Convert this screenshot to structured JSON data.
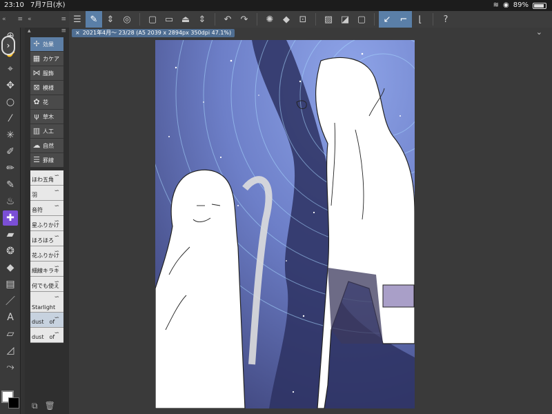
{
  "status_bar": {
    "time": "23:10",
    "date": "7月7日(水)",
    "battery": "89%",
    "battery_level": 0.89
  },
  "document": {
    "tab_title": "2021年4月～ 23/28 (A5 2039 x 2894px 350dpi 47.1%)"
  },
  "sub_tool_panel": {
    "categories": [
      {
        "label": "効果",
        "icon": "sparkle-plus-icon",
        "selected": true
      },
      {
        "label": "カケア",
        "icon": "crosshatch-icon"
      },
      {
        "label": "服飾",
        "icon": "ribbon-icon"
      },
      {
        "label": "模様",
        "icon": "pattern-icon"
      },
      {
        "label": "花",
        "icon": "flower-icon"
      },
      {
        "label": "草木",
        "icon": "grass-icon"
      },
      {
        "label": "人工",
        "icon": "building-icon"
      },
      {
        "label": "自然",
        "icon": "cloud-icon"
      },
      {
        "label": "罫線",
        "icon": "lines-icon"
      }
    ],
    "brushes": [
      {
        "label": "ほわ五角",
        "selected": false
      },
      {
        "label": "羽",
        "selected": false
      },
      {
        "label": "音符",
        "selected": false
      },
      {
        "label": "星ふりかけ",
        "selected": false
      },
      {
        "label": "ほろほろ",
        "selected": false
      },
      {
        "label": "花ふりかけ",
        "selected": false
      },
      {
        "label": "細線キラキ",
        "selected": false
      },
      {
        "label": "何でも使え",
        "selected": false
      },
      {
        "label": "Starlight",
        "selected": false
      },
      {
        "label": "dust　of",
        "selected": true
      },
      {
        "label": "dust　of",
        "selected": false
      }
    ]
  },
  "colors": {
    "accent": "#7b4fd6",
    "selected": "#5d7fa6",
    "tab": "#4f6e92",
    "main_color": "#ffffff",
    "sub_color": "#000000"
  }
}
